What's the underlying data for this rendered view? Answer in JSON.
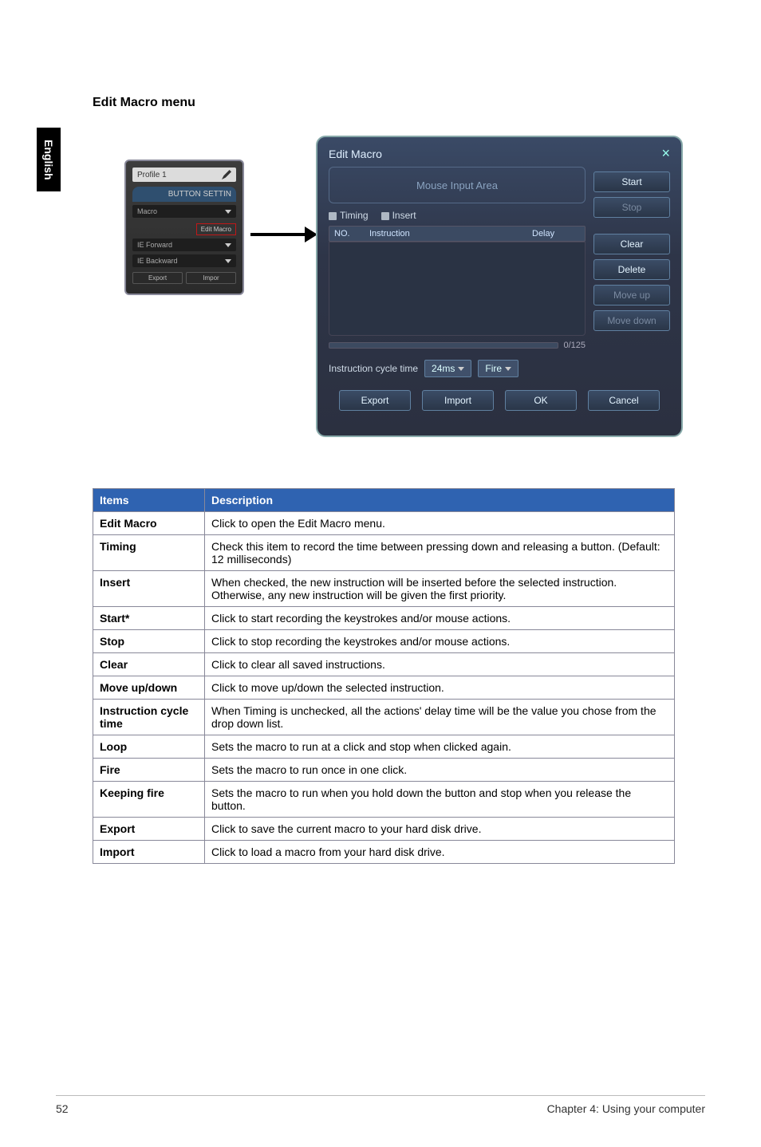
{
  "side_tab": "English",
  "section_title": "Edit Macro menu",
  "mini": {
    "profile": "Profile 1",
    "button_settin": "BUTTON SETTIN",
    "macro": "Macro",
    "edit_macro": "Edit Macro",
    "ie_forward": "IE Forward",
    "ie_backward": "IE Backward",
    "export": "Export",
    "import": "Impor"
  },
  "dialog": {
    "title": "Edit Macro",
    "mouse_area": "Mouse Input Area",
    "timing": "Timing",
    "insert": "Insert",
    "col_no": "NO.",
    "col_instruction": "Instruction",
    "col_delay": "Delay",
    "count": "0/125",
    "cycle_label": "Instruction cycle time",
    "cycle_value": "24ms",
    "fire": "Fire",
    "start": "Start",
    "stop": "Stop",
    "clear": "Clear",
    "delete": "Delete",
    "move_up": "Move up",
    "move_down": "Move down",
    "export": "Export",
    "import": "Import",
    "ok": "OK",
    "cancel": "Cancel"
  },
  "table": {
    "head_items": "Items",
    "head_desc": "Description",
    "rows": [
      {
        "label": "Edit Macro",
        "desc": "Click to open the Edit Macro menu."
      },
      {
        "label": "Timing",
        "desc": "Check this item to record the time between pressing down and releasing a button. (Default: 12 milliseconds)"
      },
      {
        "label": "Insert",
        "desc": "When checked, the new instruction will be inserted before the selected instruction. Otherwise, any new instruction will be given the first priority."
      },
      {
        "label": "Start*",
        "desc": "Click to start recording the keystrokes and/or mouse actions."
      },
      {
        "label": "Stop",
        "desc": "Click to stop recording the keystrokes and/or mouse actions."
      },
      {
        "label": "Clear",
        "desc": "Click to clear all saved instructions."
      },
      {
        "label": "Move up/down",
        "desc": "Click to move up/down the selected instruction."
      },
      {
        "label": "Instruction cycle time",
        "desc": "When Timing is unchecked, all the actions' delay time will be the value you chose from the drop down list."
      },
      {
        "label": "Loop",
        "desc": "Sets the macro to run at a click and stop when clicked again."
      },
      {
        "label": "Fire",
        "desc": "Sets the macro to run once in one click."
      },
      {
        "label": "Keeping fire",
        "desc": "Sets the macro to run when you hold down the button and stop when you release the button."
      },
      {
        "label": "Export",
        "desc": "Click to save the current macro to your hard disk drive."
      },
      {
        "label": "Import",
        "desc": "Click to load a macro from your hard disk drive."
      }
    ]
  },
  "footer": {
    "page_num": "52",
    "chapter": "Chapter 4: Using your computer"
  }
}
